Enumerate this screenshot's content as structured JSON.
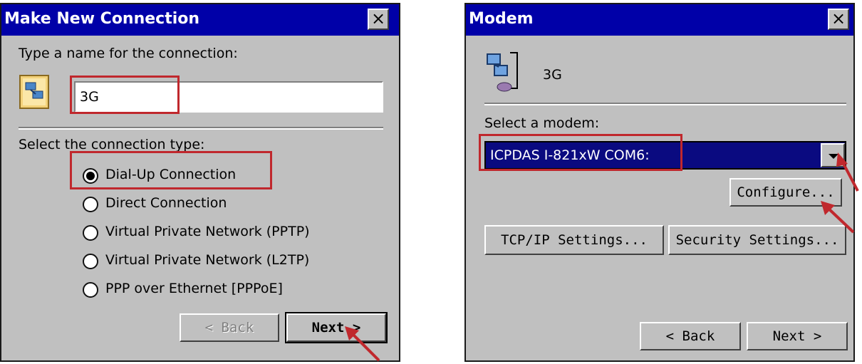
{
  "left_dialog": {
    "title": "Make New Connection",
    "close": "×",
    "name_prompt": "Type a name for the connection:",
    "name_value": "3G",
    "type_prompt": "Select the connection type:",
    "options": [
      {
        "label": "Dial-Up Connection",
        "selected": true
      },
      {
        "label": "Direct Connection",
        "selected": false
      },
      {
        "label": "Virtual Private Network (PPTP)",
        "selected": false
      },
      {
        "label": "Virtual Private Network (L2TP)",
        "selected": false
      },
      {
        "label": "PPP over Ethernet [PPPoE]",
        "selected": false
      }
    ],
    "back_label": "< Back",
    "next_label": "Next >"
  },
  "right_dialog": {
    "title": "Modem",
    "close": "×",
    "connection_name": "3G",
    "modem_prompt": "Select a modem:",
    "modem_value": "ICPDAS I-821xW COM6:",
    "configure_label": "Configure...",
    "tcpip_label": "TCP/IP Settings...",
    "security_label": "Security Settings...",
    "back_label": "< Back",
    "next_label": "Next >"
  },
  "colors": {
    "title_bar": "#0000a8",
    "dialog_bg": "#c0c0c0",
    "highlight": "#c0282d",
    "selection": "#0a0a80"
  }
}
